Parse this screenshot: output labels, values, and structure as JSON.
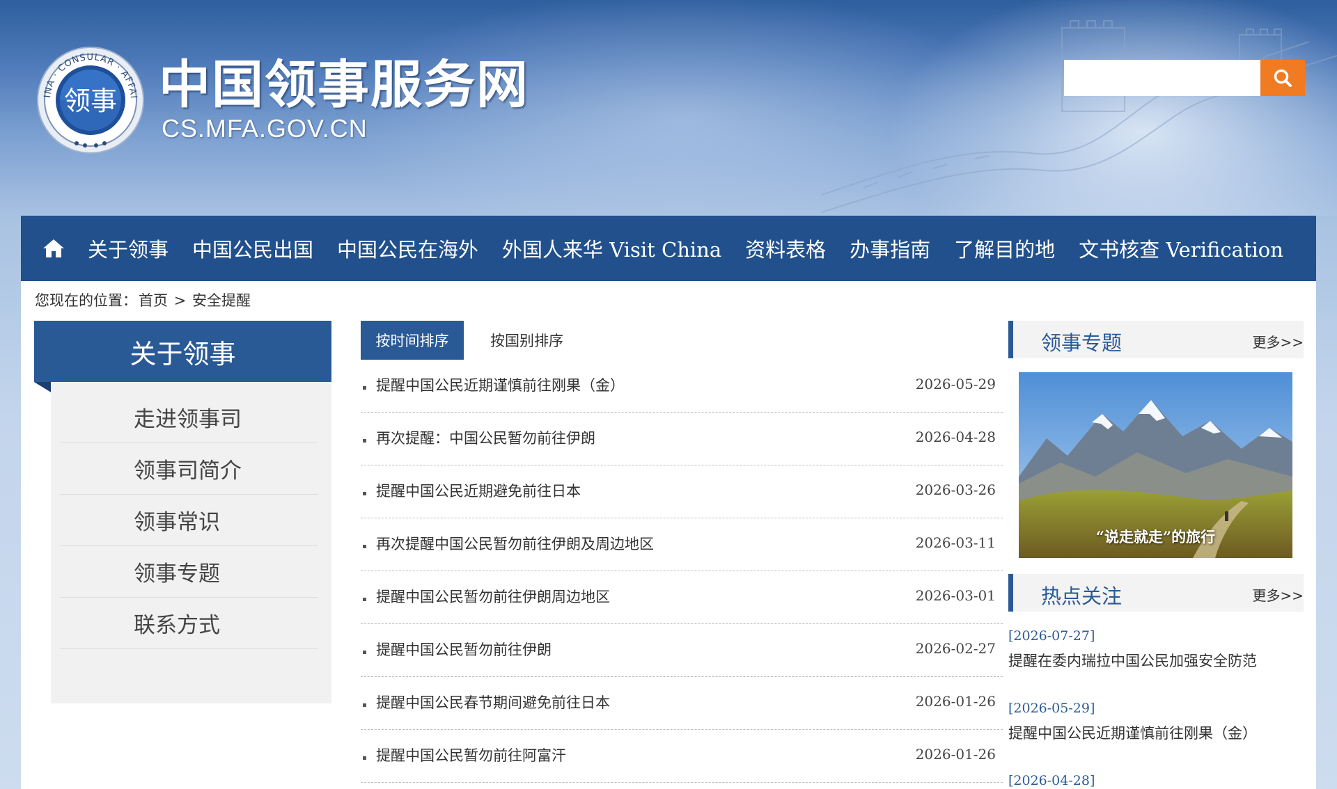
{
  "header": {
    "title": "中国领事服务网",
    "domain": "CS.MFA.GOV.CN",
    "emblem_text": "领事",
    "emblem_ring_text": "CHINA · CONSULAR · AFFAIRS",
    "search_placeholder": ""
  },
  "nav": {
    "items": [
      {
        "label": "关于领事"
      },
      {
        "label": "中国公民出国"
      },
      {
        "label": "中国公民在海外"
      },
      {
        "label": "外国人来华 Visit China"
      },
      {
        "label": "资料表格"
      },
      {
        "label": "办事指南"
      },
      {
        "label": "了解目的地"
      },
      {
        "label": "文书核查 Verification"
      }
    ]
  },
  "breadcrumb": {
    "prefix": "您现在的位置：",
    "home": "首页",
    "sep": ">",
    "current": "安全提醒"
  },
  "sidebar": {
    "title": "关于领事",
    "items": [
      {
        "label": "走进领事司"
      },
      {
        "label": "领事司简介"
      },
      {
        "label": "领事常识"
      },
      {
        "label": "领事专题"
      },
      {
        "label": "联系方式"
      }
    ]
  },
  "tabs": {
    "by_time": "按时间排序",
    "by_country": "按国别排序"
  },
  "news": [
    {
      "title": "提醒中国公民近期谨慎前往刚果（金）",
      "date": "2026-05-29"
    },
    {
      "title": "再次提醒：中国公民暂勿前往伊朗",
      "date": "2026-04-28"
    },
    {
      "title": "提醒中国公民近期避免前往日本",
      "date": "2026-03-26"
    },
    {
      "title": "再次提醒中国公民暂勿前往伊朗及周边地区",
      "date": "2026-03-11"
    },
    {
      "title": "提醒中国公民暂勿前往伊朗周边地区",
      "date": "2026-03-01"
    },
    {
      "title": "提醒中国公民暂勿前往伊朗",
      "date": "2026-02-27"
    },
    {
      "title": "提醒中国公民春节期间避免前往日本",
      "date": "2026-01-26"
    },
    {
      "title": "提醒中国公民暂勿前往阿富汗",
      "date": "2026-01-26"
    }
  ],
  "topics": {
    "title": "领事专题",
    "more": "更多>>",
    "promo_caption": "“说走就走”的旅行"
  },
  "hot": {
    "title": "热点关注",
    "more": "更多>>",
    "items": [
      {
        "date": "[2026-07-27]",
        "title": "提醒在委内瑞拉中国公民加强安全防范"
      },
      {
        "date": "[2026-05-29]",
        "title": "提醒中国公民近期谨慎前往刚果（金）"
      },
      {
        "date": "[2026-04-28]",
        "title": ""
      }
    ]
  },
  "colors": {
    "nav_blue": "#21508c",
    "accent_blue": "#2a5a96",
    "search_orange": "#f07b22"
  }
}
